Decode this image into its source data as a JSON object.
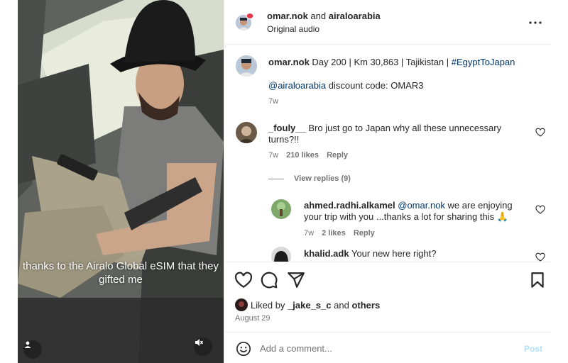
{
  "header": {
    "user": "omar.nok",
    "and": "and",
    "collab": "airaloarabia",
    "audio": "Original audio"
  },
  "post": {
    "user": "omar.nok",
    "caption": "Day 200 | Km 30,863 | Tajikistan |",
    "hashtag": "#EgyptToJapan",
    "mention": "@airaloarabia",
    "caption2": "discount code: OMAR3",
    "age": "7w"
  },
  "comments": [
    {
      "user": "_fouly__",
      "text": "Bro just go to Japan why all these unnecessary turns?!!",
      "age": "7w",
      "likes": "210 likes",
      "reply": "Reply",
      "view_replies": "View replies (9)"
    },
    {
      "user": "ahmed.radhi.alkamel",
      "mention": "@omar.nok",
      "text": "we are enjoying your trip with you ...thanks a lot for sharing this 🙏",
      "age": "7w",
      "likes": "2 likes",
      "reply": "Reply"
    },
    {
      "user": "khalid.adk",
      "text": "Your new here right?"
    }
  ],
  "video": {
    "subtitle": "thanks to the Airalo Global eSIM that they gifted me"
  },
  "likes": {
    "prefix": "Liked by",
    "user": "_jake_s_c",
    "and": "and",
    "others": "others"
  },
  "date": "August 29",
  "composer": {
    "placeholder": "Add a comment...",
    "post_label": "Post"
  },
  "colors": {
    "link": "#00376b",
    "post_disabled": "#b2dffc",
    "muted": "#737373"
  }
}
